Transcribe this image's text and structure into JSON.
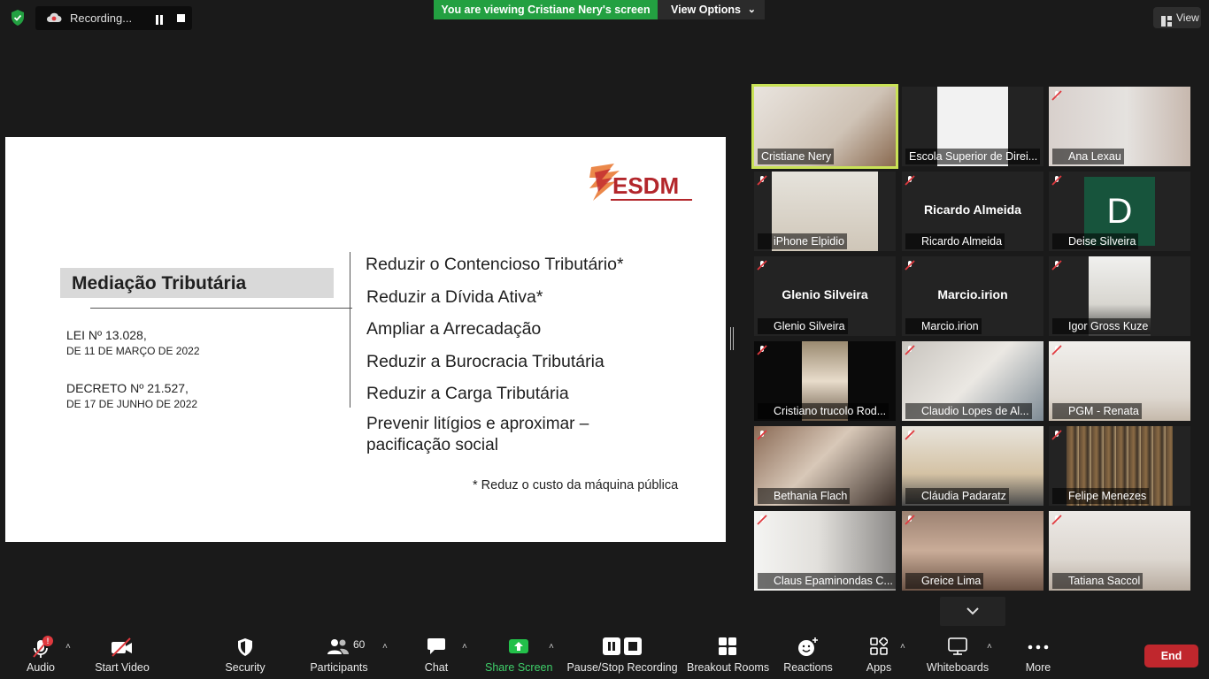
{
  "top": {
    "recording_label": "Recording...",
    "viewing_banner": "You are viewing Cristiane Nery's screen",
    "view_options": "View Options",
    "view_button": "View"
  },
  "slide": {
    "logo_text": "ESDM",
    "title": "Mediação Tributária",
    "law1": "LEI Nº 13.028,",
    "law1_date": "DE 11 DE MARÇO DE 2022",
    "law2": "DECRETO Nº 21.527,",
    "law2_date": "DE 17 DE JUNHO DE 2022",
    "bullets": [
      "Reduzir o Contencioso Tributário*",
      "Reduzir a Dívida Ativa*",
      "Ampliar a Arrecadação",
      "Reduzir a Burocracia Tributária",
      "Reduzir a Carga Tributária"
    ],
    "last_bullet_line1": "Prevenir litígios e aproximar –",
    "last_bullet_line2": "pacificação social",
    "note": "* Reduz o custo da máquina pública"
  },
  "gallery": {
    "tiles": [
      {
        "name": "Cristiane Nery"
      },
      {
        "name": "Escola Superior de Direi..."
      },
      {
        "name": "Ana Lexau"
      },
      {
        "name": "iPhone Elpidio"
      },
      {
        "name": "Ricardo Almeida",
        "big_name": "Ricardo Almeida"
      },
      {
        "name": "Deise Silveira",
        "avatar_letter": "D"
      },
      {
        "name": "Glenio Silveira",
        "big_name": "Glenio Silveira"
      },
      {
        "name": "Marcio.irion",
        "big_name": "Marcio.irion"
      },
      {
        "name": "Igor Gross Kuze"
      },
      {
        "name": "Cristiano trucolo Rod..."
      },
      {
        "name": "Claudio Lopes de Al..."
      },
      {
        "name": "PGM - Renata"
      },
      {
        "name": "Bethania Flach"
      },
      {
        "name": "Cláudia Padaratz"
      },
      {
        "name": "Felipe Menezes"
      },
      {
        "name": "Claus Epaminondas C..."
      },
      {
        "name": "Greice Lima"
      },
      {
        "name": "Tatiana Saccol"
      }
    ]
  },
  "toolbar": {
    "audio": "Audio",
    "start_video": "Start Video",
    "security": "Security",
    "participants": "Participants",
    "participants_count": "60",
    "chat": "Chat",
    "share_screen": "Share Screen",
    "pause_stop_recording": "Pause/Stop Recording",
    "breakout_rooms": "Breakout Rooms",
    "reactions": "Reactions",
    "apps": "Apps",
    "whiteboards": "Whiteboards",
    "more": "More",
    "end": "End",
    "audio_alert": "!"
  },
  "colors": {
    "active_speaker": "#c9e256",
    "share_green": "#23a041",
    "end_red": "#c0272d"
  }
}
